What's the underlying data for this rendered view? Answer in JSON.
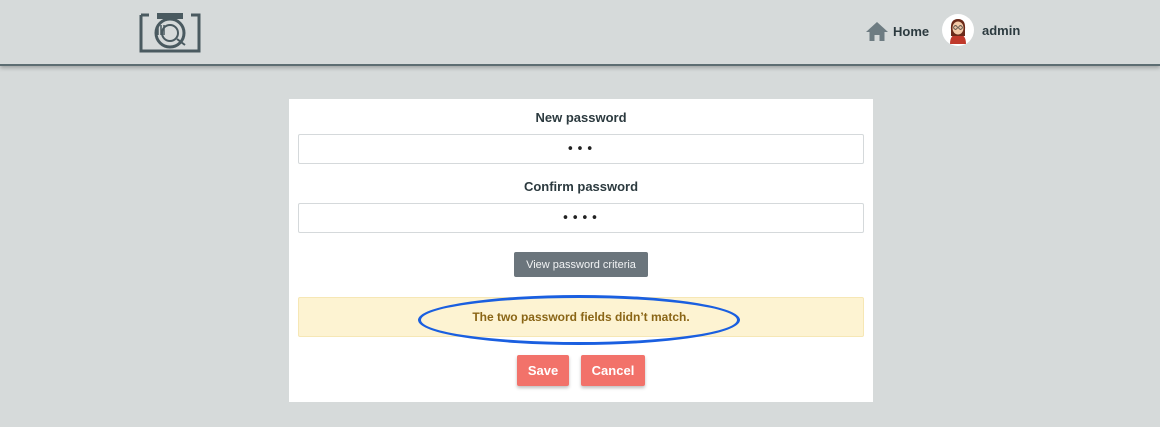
{
  "header": {
    "logo_icon": "camera-plate-logo-icon",
    "nav": {
      "home_label": "Home",
      "home_icon": "home-icon",
      "user_label": "admin",
      "avatar_icon": "user-avatar-icon"
    }
  },
  "form": {
    "new_password": {
      "label": "New password",
      "value": "•••"
    },
    "confirm_password": {
      "label": "Confirm password",
      "value": "••••"
    },
    "criteria_button_label": "View password criteria",
    "error_message": "The two password fields didn’t match.",
    "save_label": "Save",
    "cancel_label": "Cancel"
  },
  "colors": {
    "background": "#d6dada",
    "accent_button": "#f2726a",
    "alert_background": "#fdf3d2",
    "alert_text": "#8a6516",
    "highlight": "#1a5fe0"
  }
}
